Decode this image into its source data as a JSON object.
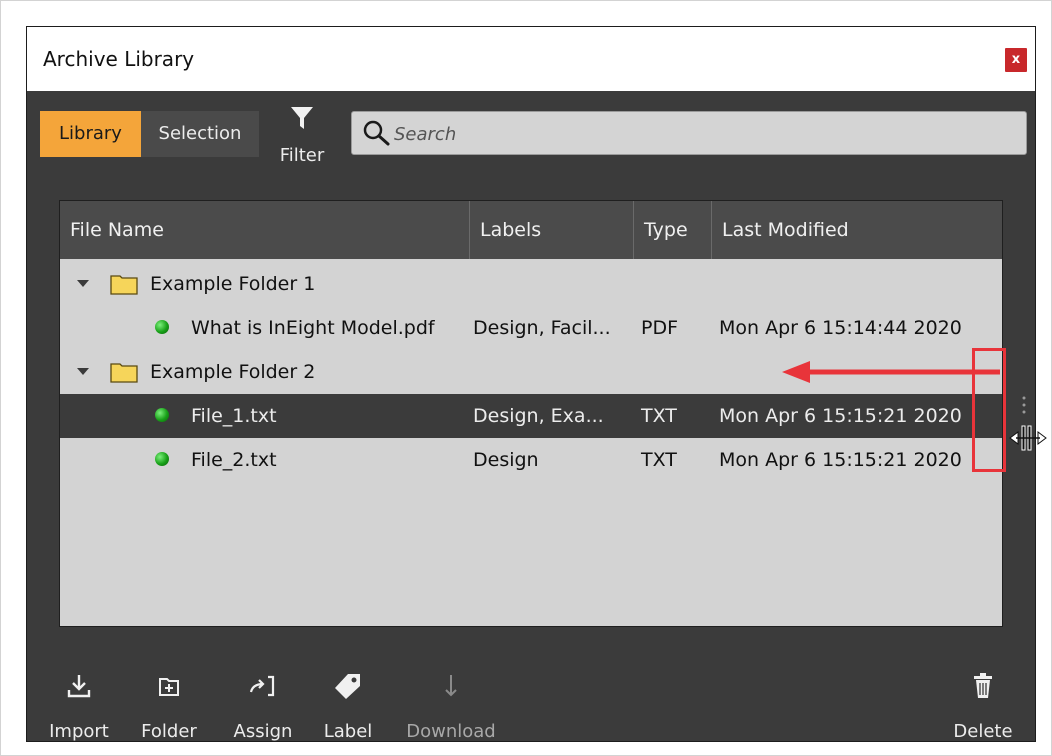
{
  "window": {
    "title": "Archive Library",
    "close_label": "x"
  },
  "toolbar": {
    "tabs": [
      {
        "label": "Library",
        "active": true
      },
      {
        "label": "Selection",
        "active": false
      }
    ],
    "filter_label": "Filter",
    "search_placeholder": "Search",
    "search_value": ""
  },
  "table": {
    "columns": [
      "File Name",
      "Labels",
      "Type",
      "Last Modified"
    ],
    "rows": [
      {
        "kind": "folder",
        "name": "Example Folder 1",
        "labels": "",
        "type": "",
        "modified": "",
        "expanded": true
      },
      {
        "kind": "file",
        "name": "What is InEight Model.pdf",
        "labels": "Design, Facil...",
        "type": "PDF",
        "modified": "Mon Apr 6 15:14:44 2020",
        "selected": false
      },
      {
        "kind": "folder",
        "name": "Example Folder 2",
        "labels": "",
        "type": "",
        "modified": "",
        "expanded": true
      },
      {
        "kind": "file",
        "name": "File_1.txt",
        "labels": "Design, Exa...",
        "type": "TXT",
        "modified": "Mon Apr 6 15:15:21 2020",
        "selected": true
      },
      {
        "kind": "file",
        "name": "File_2.txt",
        "labels": "Design",
        "type": "TXT",
        "modified": "Mon Apr 6 15:15:21 2020",
        "selected": false
      }
    ]
  },
  "bottom_toolbar": {
    "items": [
      {
        "label": "Import",
        "icon": "import-icon",
        "enabled": true
      },
      {
        "label": "Folder",
        "icon": "new-folder-icon",
        "enabled": true
      },
      {
        "label": "Assign",
        "icon": "assign-icon",
        "enabled": true
      },
      {
        "label": "Label",
        "icon": "tag-icon",
        "enabled": true
      },
      {
        "label": "Download",
        "icon": "download-icon",
        "enabled": false
      },
      {
        "label": "Delete",
        "icon": "trash-icon",
        "enabled": true
      }
    ]
  },
  "colors": {
    "active_tab": "#f4a53a",
    "window_bg": "#3b3b3b",
    "annotation": "#e8343a",
    "status_dot": "#18a018"
  }
}
